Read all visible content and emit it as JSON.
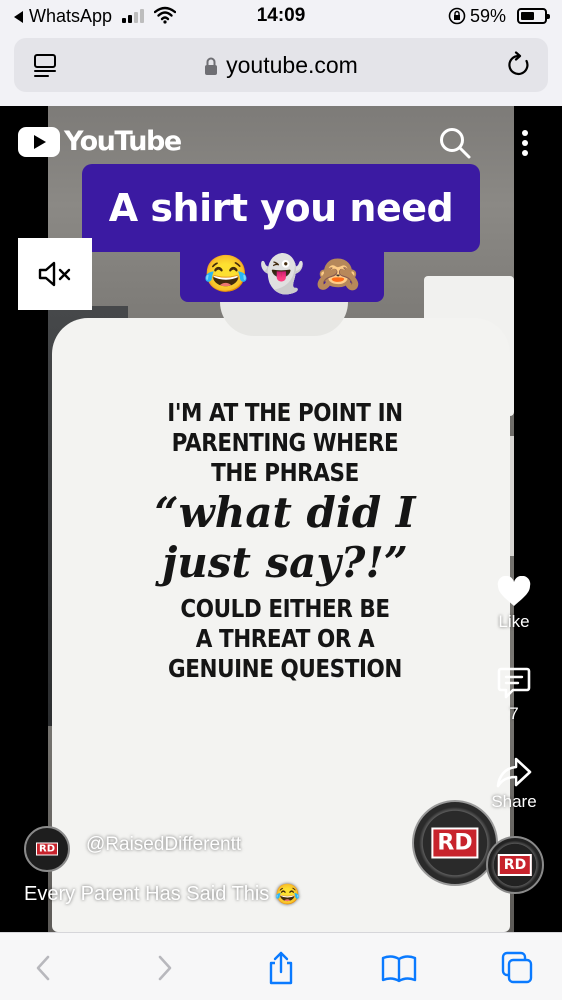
{
  "status_bar": {
    "back_app": "WhatsApp",
    "time": "14:09",
    "battery_percent": "59%",
    "battery_level": 0.59,
    "signal_bars": 2
  },
  "browser": {
    "url": "youtube.com"
  },
  "youtube": {
    "logo_text": "YouTube",
    "banner_text": "A shirt you need",
    "banner_emojis": [
      "😂",
      "👻",
      "🙈"
    ],
    "shirt_lines": [
      "I'M AT THE POINT IN",
      "PARENTING WHERE",
      "THE PHRASE"
    ],
    "shirt_script_lines": [
      "“what did I",
      "just say?!”"
    ],
    "shirt_lines_after": [
      "COULD EITHER BE",
      "A THREAT OR A",
      "GENUINE QUESTION"
    ],
    "actions": {
      "like_label": "Like",
      "comments_count": "7",
      "share_label": "Share"
    },
    "channel_handle": "@RaisedDifferentt",
    "video_title": "Every Parent Has Said This",
    "video_title_emoji": "😂",
    "watermark_text": "RD"
  },
  "icons": {
    "reader": "reader-icon",
    "lock": "lock-icon",
    "reload": "reload-icon",
    "search": "search-icon",
    "more": "more-vertical-icon",
    "mute": "mute-icon",
    "like": "heart-icon",
    "comments": "comment-icon",
    "share": "share-arrow-icon",
    "back": "chevron-left-icon",
    "forward": "chevron-right-icon",
    "share_sheet": "share-icon",
    "bookmarks": "book-icon",
    "tabs": "tabs-icon"
  },
  "colors": {
    "banner": "#3b1aa2",
    "safari_blue": "#0a7aff",
    "toolbar_disabled": "#b8b8bd"
  }
}
